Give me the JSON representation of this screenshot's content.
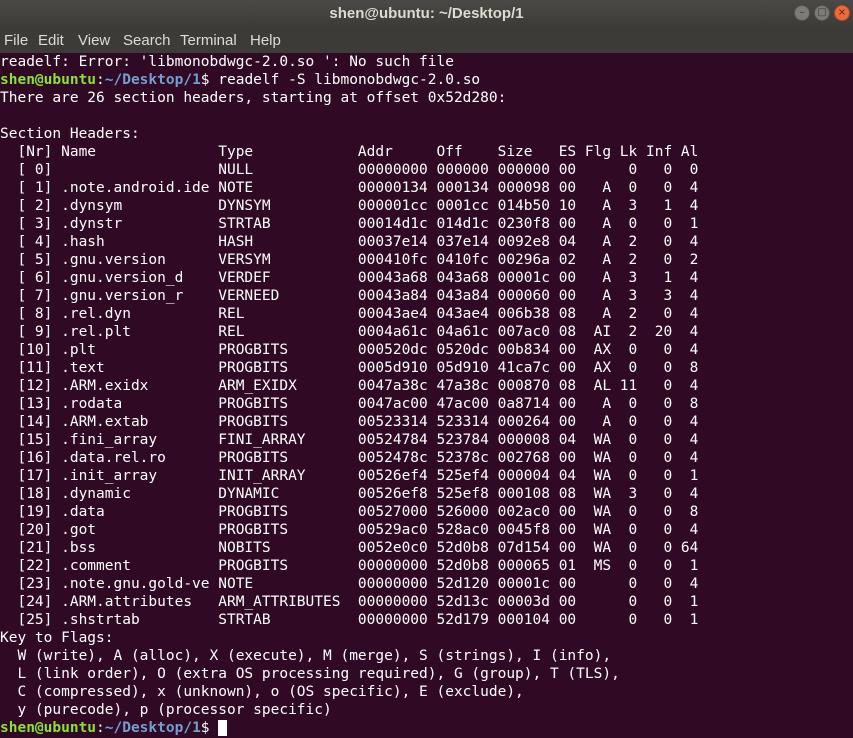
{
  "window": {
    "title": "shen@ubuntu: ~/Desktop/1",
    "icons": {
      "minimize": "minimize-icon",
      "maximize": "maximize-icon",
      "close": "close-icon"
    }
  },
  "menu": [
    "File",
    "Edit",
    "View",
    "Search",
    "Terminal",
    "Help"
  ],
  "colors": {
    "background": "#300a24",
    "prompt_user": "#8ae234",
    "prompt_path": "#729fcf",
    "text": "#ffffff",
    "titlebar": "#3c3b37",
    "close_button": "#ed6b3a"
  },
  "terminal": {
    "error_line": "readelf: Error: 'libmonobdwgc-2.0.so ': No such file",
    "prompt": {
      "user_host": "shen@ubuntu",
      "colon": ":",
      "path": "~/Desktop/1",
      "symbol": "$ "
    },
    "command": "readelf -S libmonobdwgc-2.0.so",
    "summary": "There are 26 section headers, starting at offset 0x52d280:",
    "blank": "",
    "section_title": "Section Headers:",
    "header_row": "  [Nr] Name              Type            Addr     Off    Size   ES Flg Lk Inf Al",
    "rows": [
      "  [ 0]                   NULL            00000000 000000 000000 00      0   0  0",
      "  [ 1] .note.android.ide NOTE            00000134 000134 000098 00   A  0   0  4",
      "  [ 2] .dynsym           DYNSYM          000001cc 0001cc 014b50 10   A  3   1  4",
      "  [ 3] .dynstr           STRTAB          00014d1c 014d1c 0230f8 00   A  0   0  1",
      "  [ 4] .hash             HASH            00037e14 037e14 0092e8 04   A  2   0  4",
      "  [ 5] .gnu.version      VERSYM          000410fc 0410fc 00296a 02   A  2   0  2",
      "  [ 6] .gnu.version_d    VERDEF          00043a68 043a68 00001c 00   A  3   1  4",
      "  [ 7] .gnu.version_r    VERNEED         00043a84 043a84 000060 00   A  3   3  4",
      "  [ 8] .rel.dyn          REL             00043ae4 043ae4 006b38 08   A  2   0  4",
      "  [ 9] .rel.plt          REL             0004a61c 04a61c 007ac0 08  AI  2  20  4",
      "  [10] .plt              PROGBITS        000520dc 0520dc 00b834 00  AX  0   0  4",
      "  [11] .text             PROGBITS        0005d910 05d910 41ca7c 00  AX  0   0  8",
      "  [12] .ARM.exidx        ARM_EXIDX       0047a38c 47a38c 000870 08  AL 11   0  4",
      "  [13] .rodata           PROGBITS        0047ac00 47ac00 0a8714 00   A  0   0  8",
      "  [14] .ARM.extab        PROGBITS        00523314 523314 000264 00   A  0   0  4",
      "  [15] .fini_array       FINI_ARRAY      00524784 523784 000008 04  WA  0   0  4",
      "  [16] .data.rel.ro      PROGBITS        0052478c 52378c 002768 00  WA  0   0  4",
      "  [17] .init_array       INIT_ARRAY      00526ef4 525ef4 000004 04  WA  0   0  1",
      "  [18] .dynamic          DYNAMIC         00526ef8 525ef8 000108 08  WA  3   0  4",
      "  [19] .data             PROGBITS        00527000 526000 002ac0 00  WA  0   0  8",
      "  [20] .got              PROGBITS        00529ac0 528ac0 0045f8 00  WA  0   0  4",
      "  [21] .bss              NOBITS          0052e0c0 52d0b8 07d154 00  WA  0   0 64",
      "  [22] .comment          PROGBITS        00000000 52d0b8 000065 01  MS  0   0  1",
      "  [23] .note.gnu.gold-ve NOTE            00000000 52d120 00001c 00      0   0  4",
      "  [24] .ARM.attributes   ARM_ATTRIBUTES  00000000 52d13c 00003d 00      0   0  1",
      "  [25] .shstrtab         STRTAB          00000000 52d179 000104 00      0   0  1"
    ],
    "flags_title": "Key to Flags:",
    "flags": [
      "  W (write), A (alloc), X (execute), M (merge), S (strings), I (info),",
      "  L (link order), O (extra OS processing required), G (group), T (TLS),",
      "  C (compressed), x (unknown), o (OS specific), E (exclude),",
      "  y (purecode), p (processor specific)"
    ]
  }
}
